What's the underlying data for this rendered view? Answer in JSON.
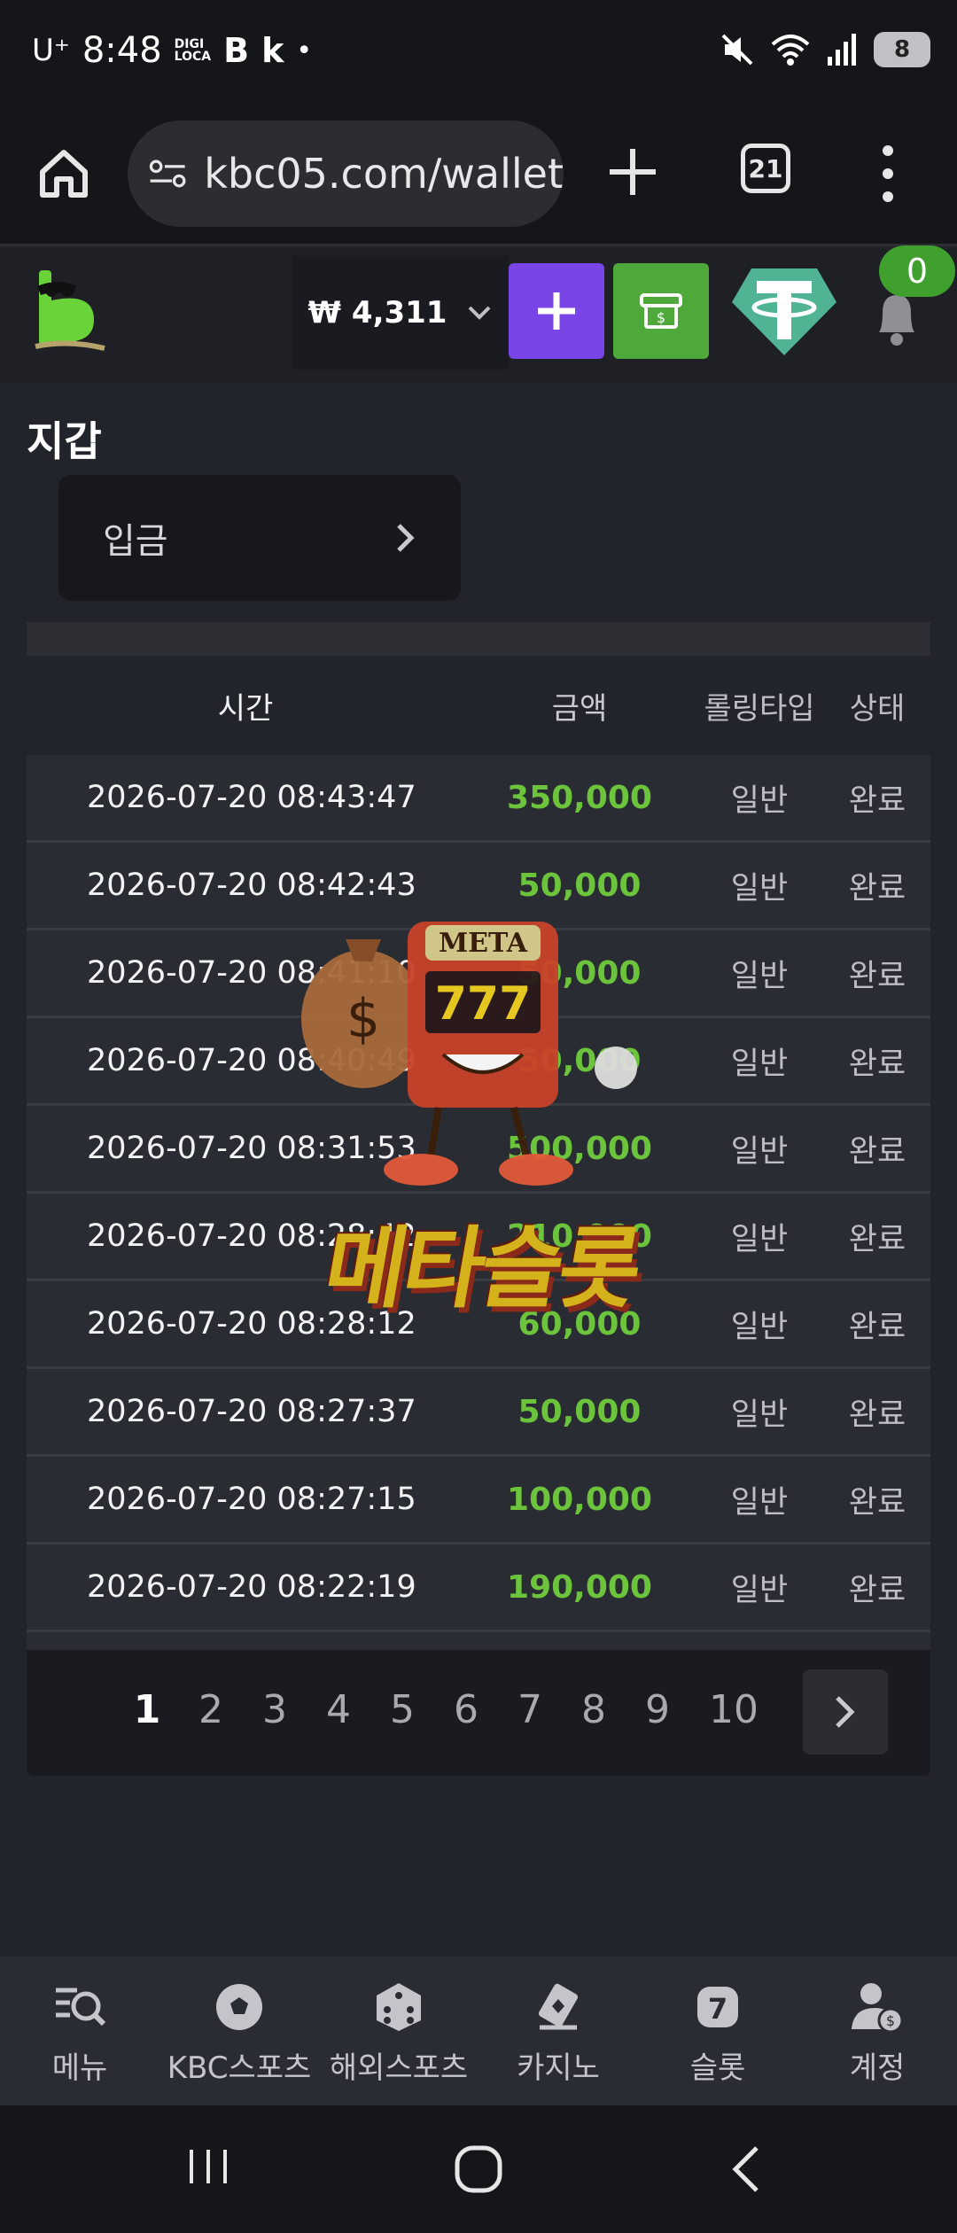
{
  "status_bar": {
    "carrier": "U⁺",
    "time": "8:48",
    "app_icons": [
      "DIGI LOCA",
      "B",
      "k",
      "•"
    ],
    "battery": "8"
  },
  "browser": {
    "url": "kbc05.com/wallet",
    "tab_count": "21"
  },
  "header": {
    "currency": "₩",
    "balance": "4,311",
    "notification_count": "0"
  },
  "page": {
    "title": "지갑",
    "deposit_button": "입금"
  },
  "table": {
    "columns": [
      "시간",
      "금액",
      "롤링타입",
      "상태"
    ],
    "rows": [
      {
        "time": "2026-07-20 08:43:47",
        "amount": "350,000",
        "rolling": "일반",
        "status": "완료"
      },
      {
        "time": "2026-07-20 08:42:43",
        "amount": "50,000",
        "rolling": "일반",
        "status": "완료"
      },
      {
        "time": "2026-07-20 08:41:10",
        "amount": "50,000",
        "rolling": "일반",
        "status": "완료"
      },
      {
        "time": "2026-07-20 08:40:49",
        "amount": "50,000",
        "rolling": "일반",
        "status": "완료"
      },
      {
        "time": "2026-07-20 08:31:53",
        "amount": "500,000",
        "rolling": "일반",
        "status": "완료"
      },
      {
        "time": "2026-07-20 08:28:42",
        "amount": "210,000",
        "rolling": "일반",
        "status": "완료"
      },
      {
        "time": "2026-07-20 08:28:12",
        "amount": "60,000",
        "rolling": "일반",
        "status": "완료"
      },
      {
        "time": "2026-07-20 08:27:37",
        "amount": "50,000",
        "rolling": "일반",
        "status": "완료"
      },
      {
        "time": "2026-07-20 08:27:15",
        "amount": "100,000",
        "rolling": "일반",
        "status": "완료"
      },
      {
        "time": "2026-07-20 08:22:19",
        "amount": "190,000",
        "rolling": "일반",
        "status": "완료"
      }
    ]
  },
  "pagination": {
    "pages": [
      "1",
      "2",
      "3",
      "4",
      "5",
      "6",
      "7",
      "8",
      "9",
      "10"
    ],
    "current": "1"
  },
  "watermark": {
    "badge": "META",
    "reels": "777",
    "text": "메타슬롯"
  },
  "bottom_nav": [
    {
      "label": "메뉴",
      "icon": "menu-search-icon"
    },
    {
      "label": "KBC스포츠",
      "icon": "soccer-ball-icon"
    },
    {
      "label": "해외스포츠",
      "icon": "dice-icon"
    },
    {
      "label": "카지노",
      "icon": "cards-icon"
    },
    {
      "label": "슬롯",
      "icon": "slot-seven-icon"
    },
    {
      "label": "계정",
      "icon": "account-icon"
    }
  ],
  "colors": {
    "amount_green": "#6cc33c",
    "purple": "#7a45e6",
    "green": "#4fa93a",
    "tether": "#4fb394"
  }
}
